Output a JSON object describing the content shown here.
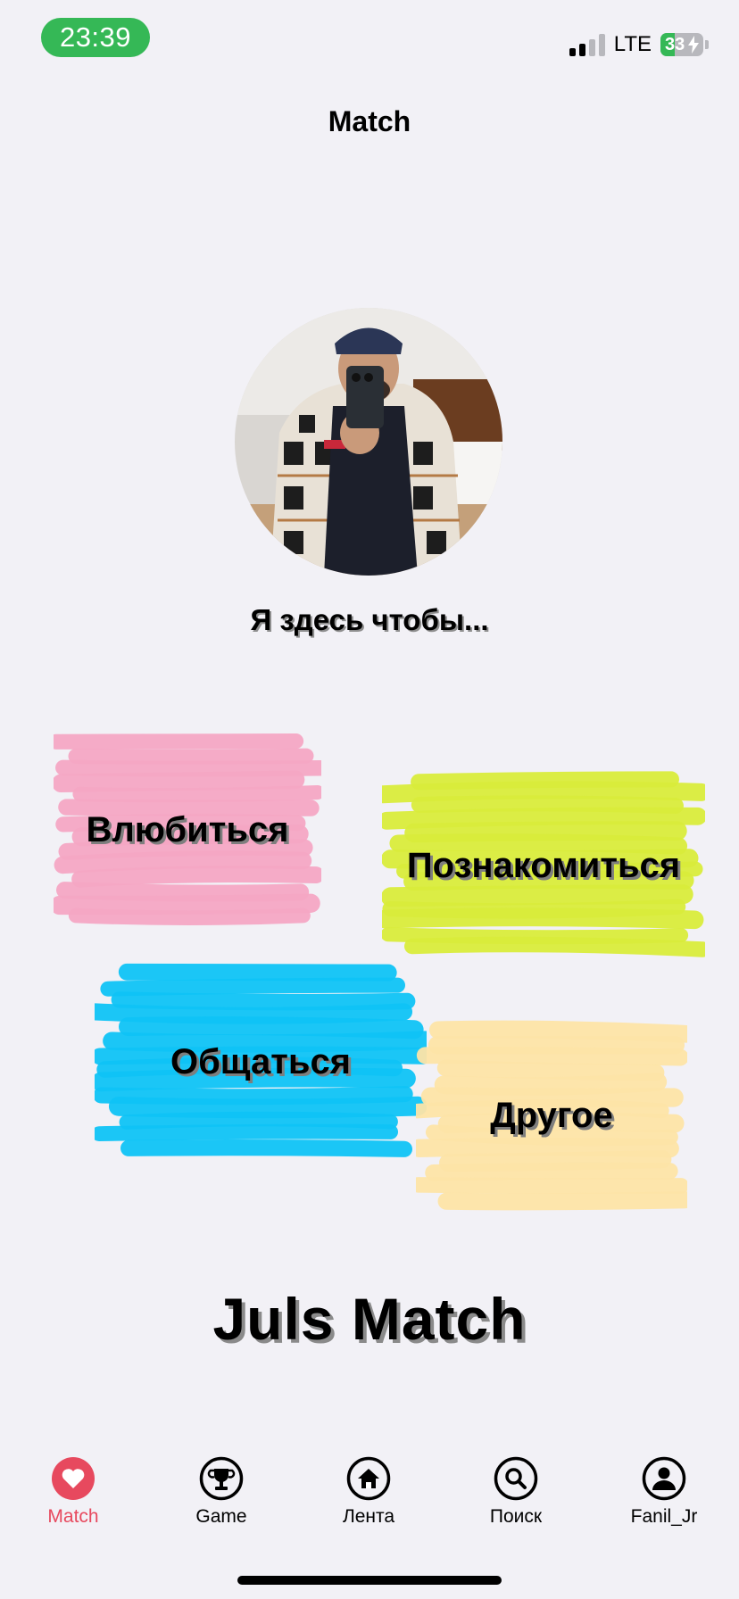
{
  "status_bar": {
    "time": "23:39",
    "network": "LTE",
    "battery": "33",
    "battery_level": 0.33,
    "signal_bars_active": 2,
    "colors": {
      "time_pill": "#35b856",
      "battery_fill": "#35b856"
    }
  },
  "header": {
    "title": "Match"
  },
  "profile": {
    "avatar_icon": "profile-photo"
  },
  "prompt": "Я здесь чтобы...",
  "choices": [
    {
      "label": "Влюбиться",
      "color": "#f4a6c4"
    },
    {
      "label": "Познакомиться",
      "color": "#d9ec3b"
    },
    {
      "label": "Общаться",
      "color": "#0fc3f5"
    },
    {
      "label": "Другое",
      "color": "#fde4a6"
    }
  ],
  "brand": "Juls Match",
  "tabbar": {
    "active_color": "#e7495e",
    "items": [
      {
        "label": "Match",
        "icon": "heart-icon",
        "active": true
      },
      {
        "label": "Game",
        "icon": "trophy-icon",
        "active": false
      },
      {
        "label": "Лента",
        "icon": "home-icon",
        "active": false
      },
      {
        "label": "Поиск",
        "icon": "search-icon",
        "active": false
      },
      {
        "label": "Fanil_Jr",
        "icon": "person-icon",
        "active": false
      }
    ]
  }
}
